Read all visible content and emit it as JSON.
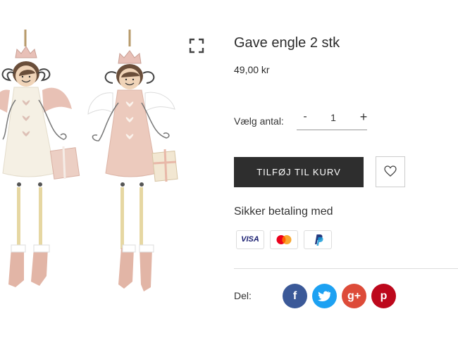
{
  "product": {
    "title": "Gave engle 2 stk",
    "price": "49,00 kr"
  },
  "quantity": {
    "label": "Vælg antal:",
    "minus": "-",
    "value": "1",
    "plus": "+"
  },
  "actions": {
    "add_to_cart": "TILFØJ TIL KURV",
    "wishlist_icon": "heart-icon"
  },
  "payment": {
    "title": "Sikker betaling med",
    "methods": [
      "VISA",
      "Mastercard",
      "PayPal"
    ]
  },
  "share": {
    "label": "Del:",
    "networks": [
      {
        "name": "facebook",
        "glyph": "f",
        "color": "#3b5998"
      },
      {
        "name": "twitter",
        "glyph": "t",
        "color": "#1da1f2"
      },
      {
        "name": "google-plus",
        "glyph": "g+",
        "color": "#dd4b39"
      },
      {
        "name": "pinterest",
        "glyph": "p",
        "color": "#bd081c"
      }
    ]
  },
  "colors": {
    "button_dark": "#2e2e2e",
    "angel_cream": "#f5f0e4",
    "angel_pink": "#eccabd"
  },
  "gallery": {
    "expand_icon": "expand-icon"
  }
}
